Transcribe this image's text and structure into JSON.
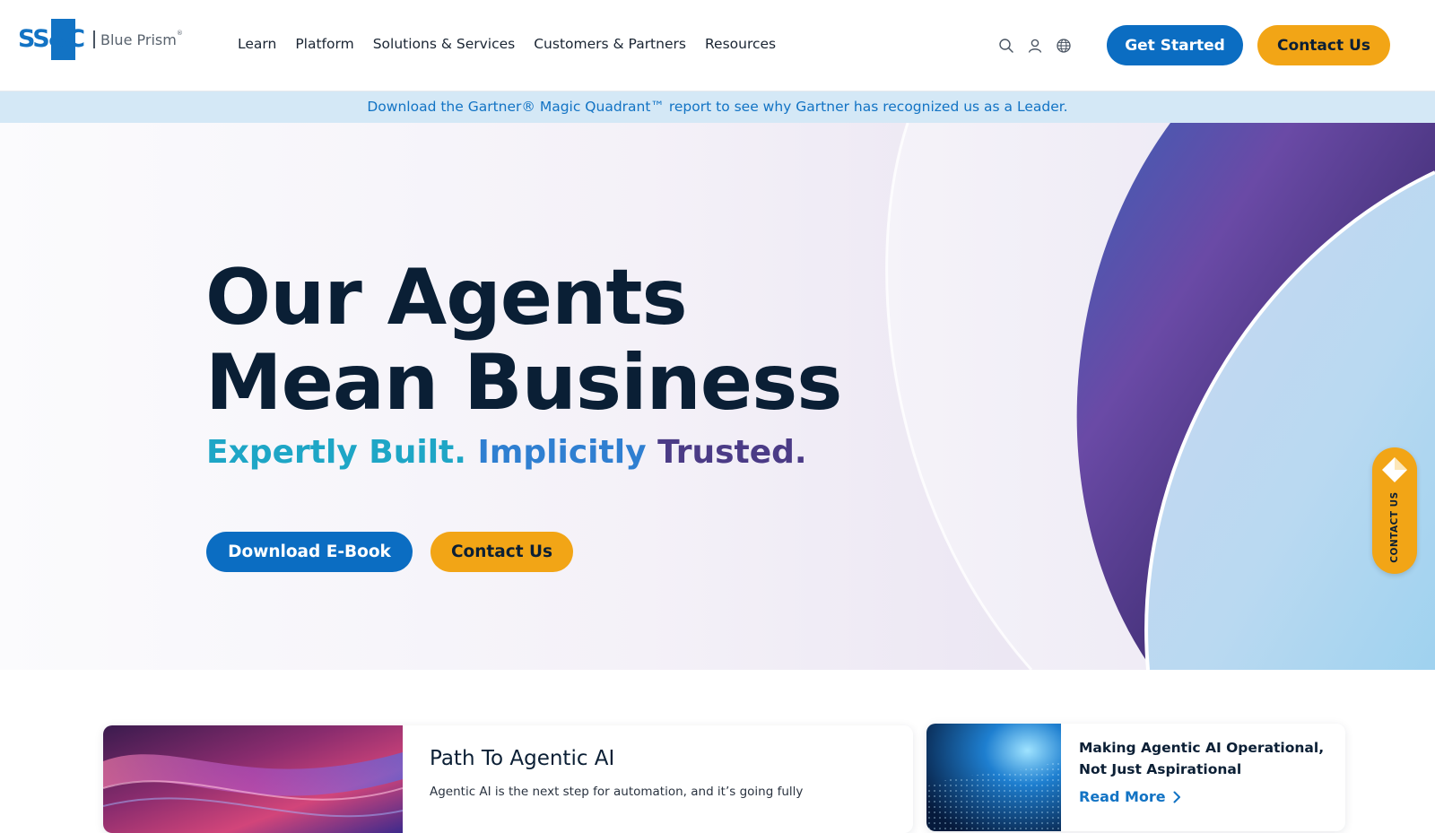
{
  "header": {
    "logo_mark": "SS&C",
    "logo_brand": "Blue Prism",
    "nav": [
      "Learn",
      "Platform",
      "Solutions & Services",
      "Customers & Partners",
      "Resources"
    ],
    "icons": [
      "search-icon",
      "user-icon",
      "globe-icon"
    ],
    "get_started_label": "Get Started",
    "contact_label": "Contact Us"
  },
  "banner": {
    "text": "Download the Gartner® Magic Quadrant™ report to see why Gartner has recognized us as a Leader."
  },
  "hero": {
    "title_line1": "Our Agents",
    "title_line2": "Mean Business",
    "tagline": {
      "part1": "Expertly Built.",
      "part2": "Implicitly",
      "part3": "Trusted."
    },
    "download_label": "Download E-Book",
    "contact_label": "Contact Us"
  },
  "side_tab": {
    "label": "CONTACT US"
  },
  "cards": {
    "main": {
      "title": "Path To Agentic AI",
      "description": "Agentic AI is the next step for automation, and it’s going fully"
    },
    "side": {
      "title": "Making Agentic AI Operational, Not Just Aspirational",
      "link_label": "Read More"
    }
  },
  "colors": {
    "primary_blue": "#0b6dc2",
    "accent_gold": "#f2a516",
    "banner_bg": "#d4e8f6",
    "heading_navy": "#0a1f35",
    "tag_teal": "#1ea6c6",
    "tag_purple": "#4b3b86"
  }
}
